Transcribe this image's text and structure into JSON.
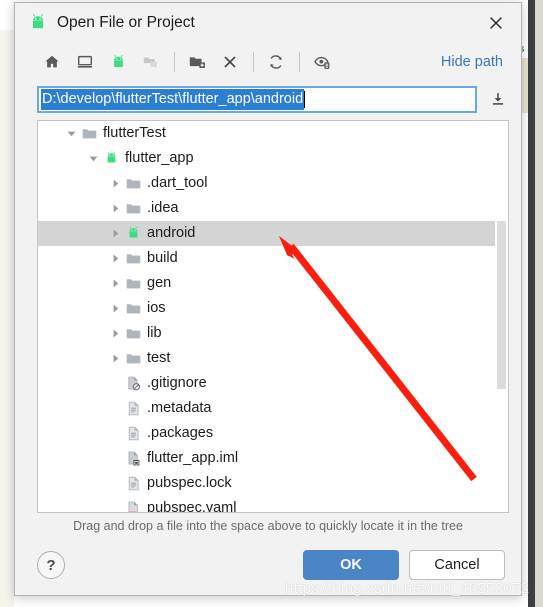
{
  "window": {
    "title": "Open File or Project",
    "title_icon": "android-icon",
    "close_icon": "close-icon"
  },
  "toolbar": {
    "items": [
      {
        "name": "home-button",
        "icon": "home-icon",
        "enabled": true
      },
      {
        "name": "desktop-button",
        "icon": "desktop-icon",
        "enabled": true
      },
      {
        "name": "project-dir-button",
        "icon": "android-icon",
        "enabled": true
      },
      {
        "name": "recent-dirs-button",
        "icon": "folders-icon",
        "enabled": false
      },
      {
        "name": "new-folder-button",
        "icon": "new-folder-icon",
        "enabled": true
      },
      {
        "name": "delete-button",
        "icon": "close-x-icon",
        "enabled": true
      },
      {
        "name": "refresh-button",
        "icon": "refresh-icon",
        "enabled": true
      },
      {
        "name": "show-hidden-button",
        "icon": "show-hidden-icon",
        "enabled": true
      }
    ],
    "hide_path_label": "Hide path"
  },
  "path_field": {
    "value": "D:\\develop\\flutterTest\\flutter_app\\android",
    "selected": true,
    "download_icon": "download-icon"
  },
  "tree": {
    "rows": [
      {
        "label": "flutterTest",
        "indent": 1,
        "twisty": "down",
        "icon": "folder-icon",
        "selected": false
      },
      {
        "label": "flutter_app",
        "indent": 2,
        "twisty": "down",
        "icon": "android-icon",
        "selected": false
      },
      {
        "label": ".dart_tool",
        "indent": 3,
        "twisty": "right",
        "icon": "folder-icon",
        "selected": false
      },
      {
        "label": ".idea",
        "indent": 3,
        "twisty": "right",
        "icon": "folder-icon",
        "selected": false
      },
      {
        "label": "android",
        "indent": 3,
        "twisty": "right",
        "icon": "android-icon",
        "selected": true
      },
      {
        "label": "build",
        "indent": 3,
        "twisty": "right",
        "icon": "folder-icon",
        "selected": false
      },
      {
        "label": "gen",
        "indent": 3,
        "twisty": "right",
        "icon": "folder-icon",
        "selected": false
      },
      {
        "label": "ios",
        "indent": 3,
        "twisty": "right",
        "icon": "folder-icon",
        "selected": false
      },
      {
        "label": "lib",
        "indent": 3,
        "twisty": "right",
        "icon": "folder-icon",
        "selected": false
      },
      {
        "label": "test",
        "indent": 3,
        "twisty": "right",
        "icon": "folder-icon",
        "selected": false
      },
      {
        "label": ".gitignore",
        "indent": 3,
        "twisty": "none",
        "icon": "file-ignore-icon",
        "selected": false
      },
      {
        "label": ".metadata",
        "indent": 3,
        "twisty": "none",
        "icon": "file-text-icon",
        "selected": false
      },
      {
        "label": ".packages",
        "indent": 3,
        "twisty": "none",
        "icon": "file-text-icon",
        "selected": false
      },
      {
        "label": "flutter_app.iml",
        "indent": 3,
        "twisty": "none",
        "icon": "file-iml-icon",
        "selected": false
      },
      {
        "label": "pubspec.lock",
        "indent": 3,
        "twisty": "none",
        "icon": "file-text-icon",
        "selected": false
      },
      {
        "label": "pubspec.yaml",
        "indent": 3,
        "twisty": "none",
        "icon": "file-yml-icon",
        "selected": false
      }
    ]
  },
  "hint": "Drag and drop a file into the space above to quickly locate it in the tree",
  "buttons": {
    "help_label": "?",
    "ok_label": "OK",
    "cancel_label": "Cancel"
  },
  "background": {
    "green_glyph": "s"
  },
  "watermark": "https://blog.csdn.net/m0_46553072",
  "colors": {
    "android_green": "#3ddc84",
    "accent_blue": "#4a86c5",
    "link_blue": "#3a76bd",
    "selection_blue": "#2a7fd4",
    "row_selected": "#d4d4d4",
    "annotation_red": "#fa1e0e"
  }
}
